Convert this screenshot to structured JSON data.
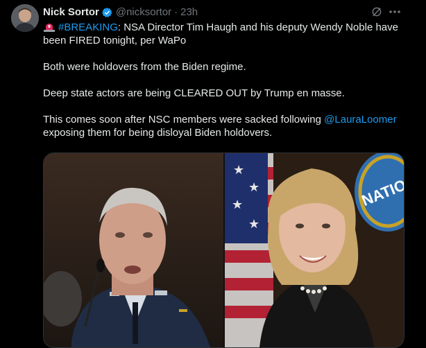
{
  "tweet": {
    "author_name": "Nick Sortor",
    "handle": "@nicksortor",
    "separator": "·",
    "time": "23h",
    "paragraphs": {
      "p1_tag": "#BREAKING",
      "p1_text": ": NSA Director Tim Haugh and his deputy Wendy Noble have been FIRED tonight, per WaPo",
      "p2": "Both were holdovers from the Biden regime.",
      "p3": "Deep state actors are being CLEARED OUT by Trump en masse.",
      "p4_before": "This comes soon after NSC members were sacked following ",
      "p4_mention": "@LauraLoomer",
      "p4_after": " exposing them for being disloyal Biden holdovers."
    },
    "media": {
      "right_sign_text": "NATIO"
    }
  },
  "colors": {
    "background": "#000000",
    "text": "#e7e9ea",
    "secondary": "#71767b",
    "link": "#1d9bf0",
    "verified": "#1d9bf0"
  },
  "icons": {
    "verified": "verified-badge-icon",
    "siren": "siren-emoji-icon",
    "grok": "grok-icon",
    "more": "more-dots-icon"
  }
}
